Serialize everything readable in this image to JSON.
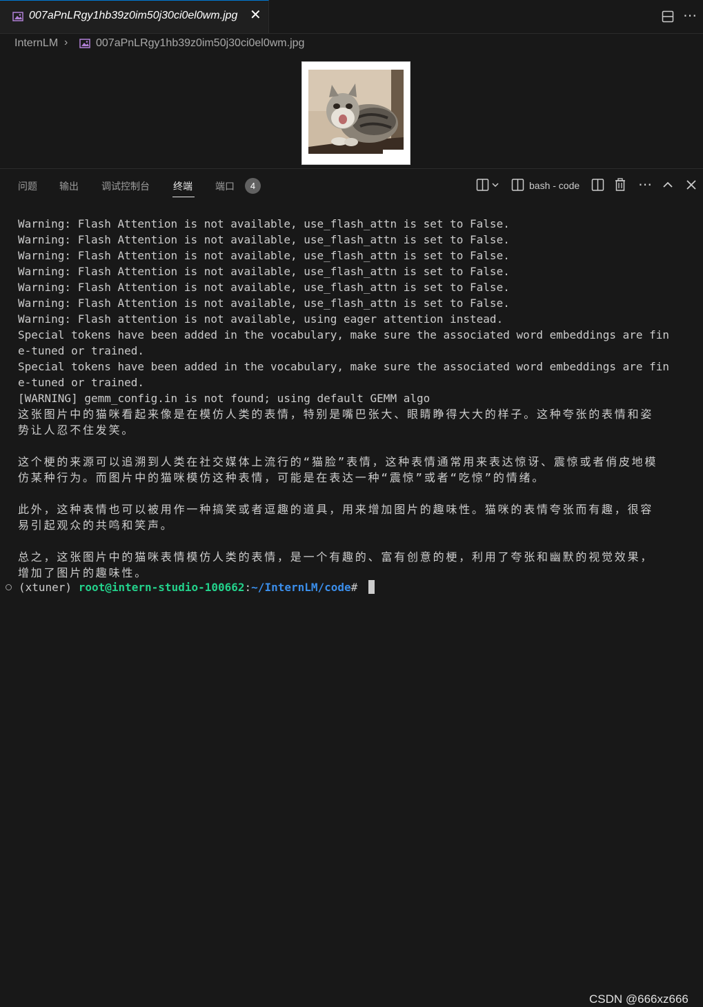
{
  "editor": {
    "tab_title": "007aPnLRgy1hb39z0im50j30ci0el0wm.jpg",
    "breadcrumb_root": "InternLM",
    "breadcrumb_file": "007aPnLRgy1hb39z0im50j30ci0el0wm.jpg"
  },
  "panel": {
    "tabs": [
      {
        "label": "问题"
      },
      {
        "label": "输出"
      },
      {
        "label": "调试控制台"
      },
      {
        "label": "终端",
        "active": true
      },
      {
        "label": "端口"
      }
    ],
    "ports_badge": "4",
    "terminal_name": "bash - code"
  },
  "terminal": {
    "lines": [
      "Warning: Flash Attention is not available, use_flash_attn is set to False.",
      "Warning: Flash Attention is not available, use_flash_attn is set to False.",
      "Warning: Flash Attention is not available, use_flash_attn is set to False.",
      "Warning: Flash Attention is not available, use_flash_attn is set to False.",
      "Warning: Flash Attention is not available, use_flash_attn is set to False.",
      "Warning: Flash Attention is not available, use_flash_attn is set to False.",
      "Warning: Flash attention is not available, using eager attention instead.",
      "Special tokens have been added in the vocabulary, make sure the associated word embeddings are fin",
      "e-tuned or trained.",
      "Special tokens have been added in the vocabulary, make sure the associated word embeddings are fin",
      "e-tuned or trained.",
      "[WARNING] gemm_config.in is not found; using default GEMM algo",
      "这张图片中的猫咪看起来像是在模仿人类的表情，特别是嘴巴张大、眼睛睁得大大的样子。这种夸张的表情和姿",
      "势让人忍不住发笑。",
      "",
      "这个梗的来源可以追溯到人类在社交媒体上流行的“猫脸”表情，这种表情通常用来表达惊讶、震惊或者俏皮地模",
      "仿某种行为。而图片中的猫咪模仿这种表情，可能是在表达一种“震惊”或者“吃惊”的情绪。",
      "",
      "此外，这种表情也可以被用作一种搞笑或者逗趣的道具，用来增加图片的趣味性。猫咪的表情夸张而有趣，很容",
      "易引起观众的共鸣和笑声。",
      "",
      "总之，这张图片中的猫咪表情模仿人类的表情，是一个有趣的、富有创意的梗，利用了夸张和幽默的视觉效果，",
      "增加了图片的趣味性。"
    ],
    "prompt_env": "(xtuner) ",
    "prompt_user": "root@intern-studio-100662",
    "prompt_sep": ":",
    "prompt_path": "~/InternLM/code",
    "prompt_end": "# "
  },
  "watermark": "CSDN @666xz666"
}
